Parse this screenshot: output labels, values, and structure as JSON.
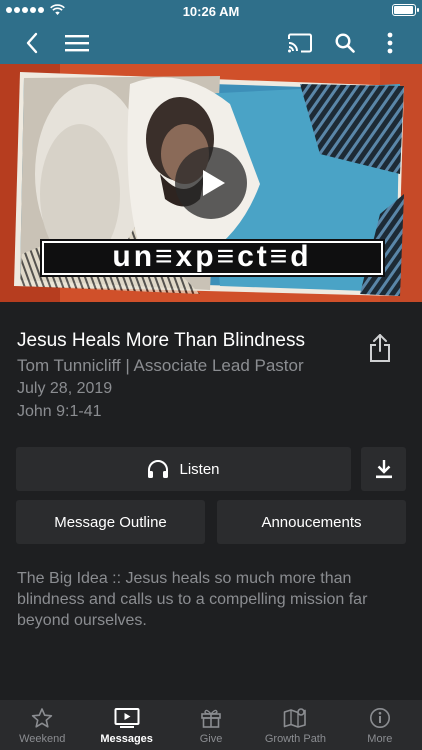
{
  "status_bar": {
    "time": "10:26 AM"
  },
  "nav": {
    "back": "back-icon",
    "menu": "hamburger-menu-icon",
    "cast": "cast-icon",
    "search": "search-icon",
    "more": "more-vertical-icon"
  },
  "hero": {
    "series_title": "un≡xp≡ct≡d"
  },
  "message": {
    "title": "Jesus Heals More Than Blindness",
    "speaker": "Tom Tunnicliff | Associate Lead Pastor",
    "date": "July 28, 2019",
    "scripture": "John 9:1-41",
    "description": "The Big Idea :: Jesus heals so much more than blindness and calls us to a compelling mission far beyond ourselves."
  },
  "actions": {
    "listen": "Listen",
    "outline": "Message Outline",
    "announcements": "Annoucements"
  },
  "tabs": [
    {
      "label": "Weekend",
      "icon": "star-icon"
    },
    {
      "label": "Messages",
      "icon": "play-screen-icon"
    },
    {
      "label": "Give",
      "icon": "gift-icon"
    },
    {
      "label": "Growth Path",
      "icon": "map-pin-icon"
    },
    {
      "label": "More",
      "icon": "info-icon"
    }
  ],
  "colors": {
    "header": "#2f6f8a",
    "background": "#1e1f21",
    "button": "#2b2c2e",
    "muted_text": "#8b8d91"
  }
}
